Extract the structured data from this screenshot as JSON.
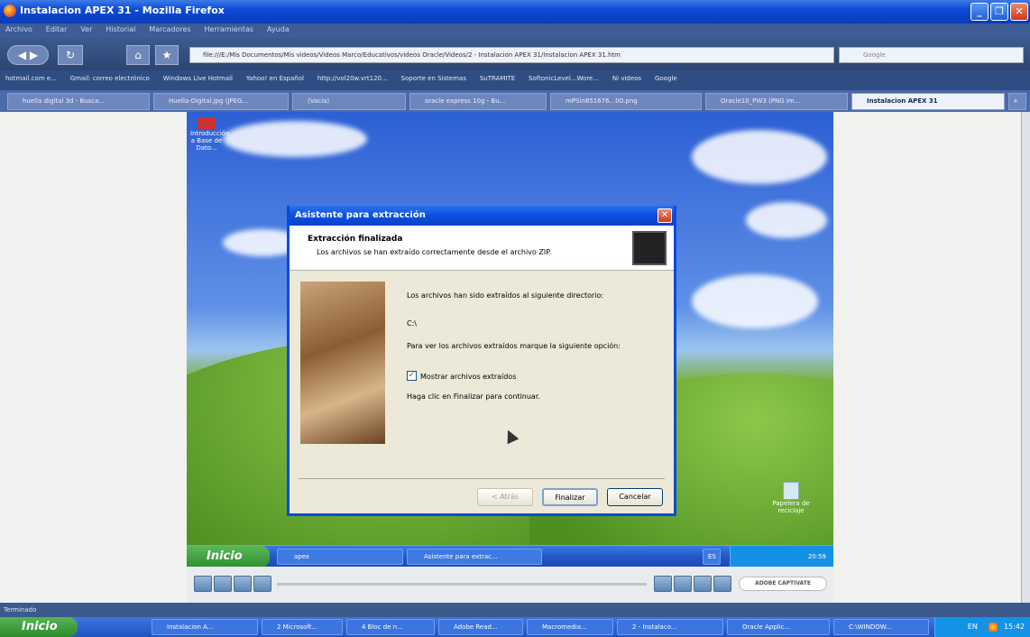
{
  "browser": {
    "title": "Instalacion APEX 31 - Mozilla Firefox",
    "menu": [
      "Archivo",
      "Editar",
      "Ver",
      "Historial",
      "Marcadores",
      "Herramientas",
      "Ayuda"
    ],
    "url": "file:///E:/Mis Documentos/Mis videos/Videos Marco/Educativos/videos Oracle/Videos/2 - Instalacion APEX 31/Instalacion APEX 31.htm",
    "search_placeholder": "Google",
    "bookmarks": [
      "hotmail.com e...",
      "Gmail: correo electrónico",
      "Windows Live Hotmail",
      "Yahoo! en Español",
      "http://vol20w.vrt120...",
      "Soporte en Sistemas",
      "SuTRAMITE",
      "SoftonicLevel...Wore...",
      "Ni videos",
      "Google"
    ],
    "tabs": [
      "huella digital 3d - Busca...",
      "Huella-Digital.jpg (JPEG...",
      "(Vacía)",
      "oracle express 10g - Bu...",
      "mPSin851676...00.png",
      "Oracle10_PW3 (PNG Im...",
      "Instalacion APEX 31"
    ],
    "status": "Terminado"
  },
  "desktop": {
    "icon_top": "Introducción a Base de Dato...",
    "recycle_bin": "Papelera de reciclaje",
    "start_label": "Inicio",
    "tasks": [
      "apex",
      "Asistente para extrac..."
    ],
    "clock": "20:59",
    "tray_tag": "ES"
  },
  "dialog": {
    "title": "Asistente para extracción",
    "header_title": "Extracción finalizada",
    "header_subtitle": "Los archivos se han extraído correctamente desde el archivo ZIP.",
    "line1": "Los archivos han sido extraídos al siguiente directorio:",
    "directory": "C:\\",
    "line2": "Para ver los archivos extraídos marque la siguiente opción:",
    "checkbox_label": "Mostrar archivos extraídos",
    "checkbox_checked": true,
    "line3": "Haga clic en Finalizar para continuar.",
    "btn_back": "< Atrás",
    "btn_finish": "Finalizar",
    "btn_cancel": "Cancelar"
  },
  "player": {
    "badge": "ADOBE CAPTIVATE"
  },
  "taskbar": {
    "start_label": "Inicio",
    "tasks": [
      "Instalacion A...",
      "2 Microsoft...",
      "4 Bloc de n...",
      "Adobe Read...",
      "Macromedia...",
      "2 - Instalaco...",
      "Oracle Applic...",
      "C:\\WINDOW..."
    ],
    "lang": "EN",
    "clock": "15:42"
  }
}
